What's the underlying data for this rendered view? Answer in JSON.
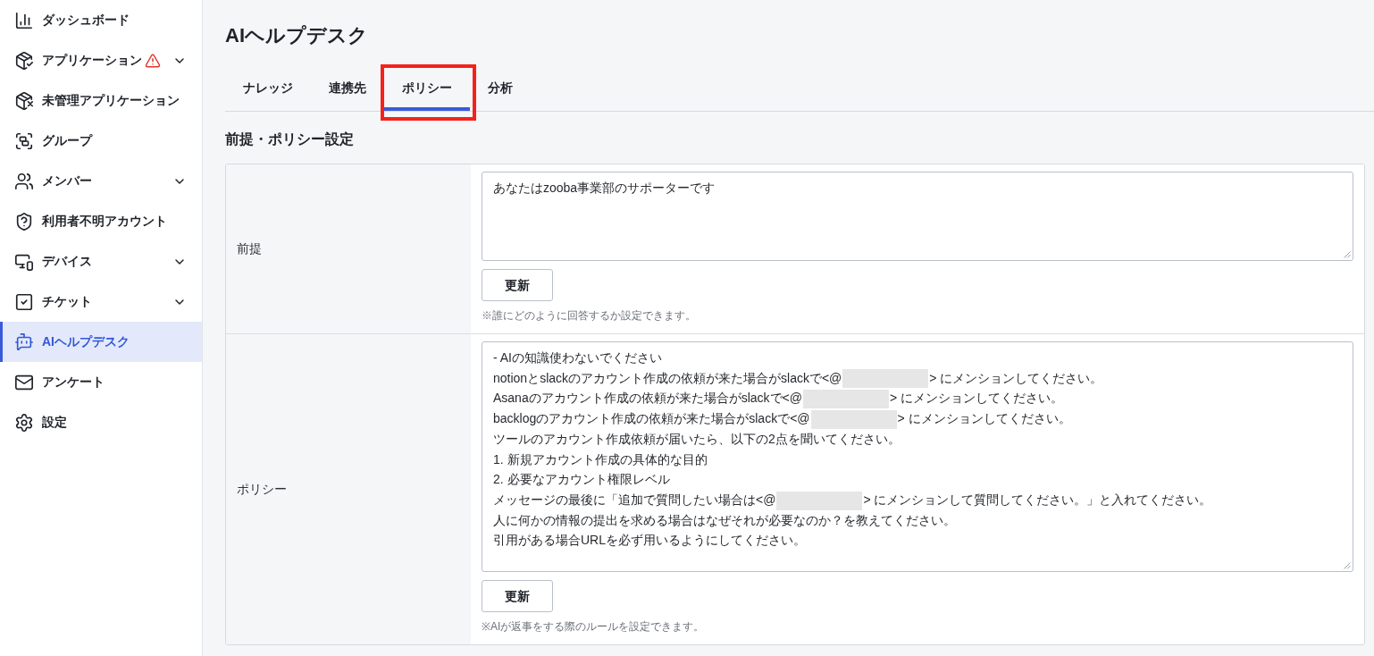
{
  "sidebar": {
    "items": [
      {
        "label": "ダッシュボード",
        "selected": false,
        "expandable": false,
        "alert": false
      },
      {
        "label": "アプリケーション",
        "selected": false,
        "expandable": true,
        "alert": true
      },
      {
        "label": "未管理アプリケーション",
        "selected": false,
        "expandable": false,
        "alert": false
      },
      {
        "label": "グループ",
        "selected": false,
        "expandable": false,
        "alert": false
      },
      {
        "label": "メンバー",
        "selected": false,
        "expandable": true,
        "alert": false
      },
      {
        "label": "利用者不明アカウント",
        "selected": false,
        "expandable": false,
        "alert": false
      },
      {
        "label": "デバイス",
        "selected": false,
        "expandable": true,
        "alert": false
      },
      {
        "label": "チケット",
        "selected": false,
        "expandable": true,
        "alert": false
      },
      {
        "label": "AIヘルプデスク",
        "selected": true,
        "expandable": false,
        "alert": false
      },
      {
        "label": "アンケート",
        "selected": false,
        "expandable": false,
        "alert": false
      },
      {
        "label": "設定",
        "selected": false,
        "expandable": false,
        "alert": false
      }
    ]
  },
  "page": {
    "title": "AIヘルプデスク"
  },
  "tabs": [
    {
      "label": "ナレッジ",
      "selected": false,
      "highlighted": false
    },
    {
      "label": "連携先",
      "selected": false,
      "highlighted": false
    },
    {
      "label": "ポリシー",
      "selected": true,
      "highlighted": true
    },
    {
      "label": "分析",
      "selected": false,
      "highlighted": false
    }
  ],
  "section": {
    "title": "前提・ポリシー設定",
    "rows": [
      {
        "label": "前提",
        "lines": [
          [
            {
              "kind": "text",
              "text": "あなたはzooba事業部のサポーターです"
            }
          ]
        ],
        "button": "更新",
        "hint": "※誰にどのように回答するか設定できます。"
      },
      {
        "label": "ポリシー",
        "lines": [
          [
            {
              "kind": "text",
              "text": "- AIの知識使わないでください"
            }
          ],
          [
            {
              "kind": "text",
              "text": "notionとslackのアカウント作成の依頼が来た場合がslackで<@"
            },
            {
              "kind": "redacted"
            },
            {
              "kind": "text",
              "text": "> にメンションしてください。"
            }
          ],
          [
            {
              "kind": "text",
              "text": "Asanaのアカウント作成の依頼が来た場合がslackで<@"
            },
            {
              "kind": "redacted"
            },
            {
              "kind": "text",
              "text": "> にメンションしてください。"
            }
          ],
          [
            {
              "kind": "text",
              "text": "backlogのアカウント作成の依頼が来た場合がslackで<@"
            },
            {
              "kind": "redacted"
            },
            {
              "kind": "text",
              "text": "> にメンションしてください。"
            }
          ],
          [
            {
              "kind": "text",
              "text": "ツールのアカウント作成依頼が届いたら、以下の2点を聞いてください。"
            }
          ],
          [
            {
              "kind": "text",
              "text": "1. 新規アカウント作成の具体的な目的"
            }
          ],
          [
            {
              "kind": "text",
              "text": "2. 必要なアカウント権限レベル"
            }
          ],
          [
            {
              "kind": "text",
              "text": "メッセージの最後に「追加で質問したい場合は<@"
            },
            {
              "kind": "redacted"
            },
            {
              "kind": "text",
              "text": "> にメンションして質問してください。」と入れてください。"
            }
          ],
          [
            {
              "kind": "text",
              "text": "人に何かの情報の提出を求める場合はなぜそれが必要なのか？を教えてください。"
            }
          ],
          [
            {
              "kind": "text",
              "text": "引用がある場合URLを必ず用いるようにしてください。"
            }
          ]
        ],
        "button": "更新",
        "hint": "※AIが返事をする際のルールを設定できます。"
      }
    ]
  }
}
